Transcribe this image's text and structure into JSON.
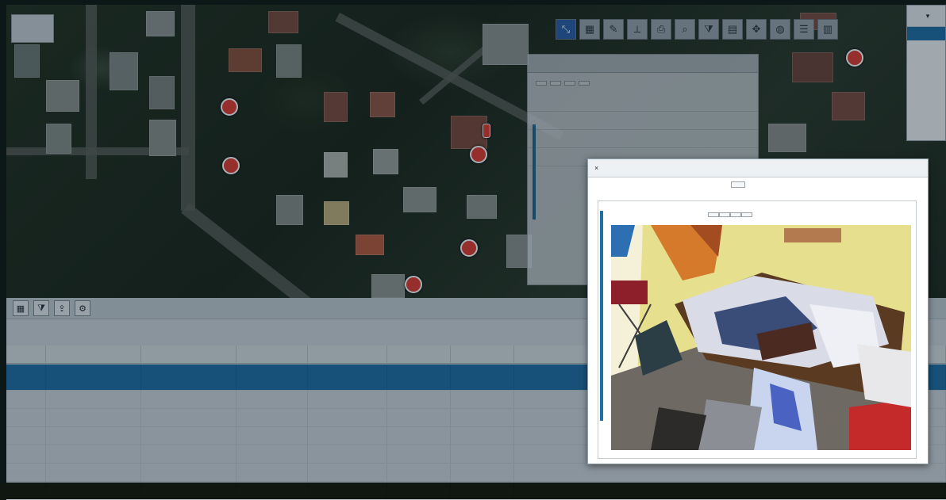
{
  "colors": {
    "accent": "#1f6fa5",
    "marker": "#e23a2f",
    "toolbar_active": "#2a5fa8"
  },
  "map": {
    "logo": "",
    "markers": [
      "",
      "",
      "",
      "",
      "",
      "",
      ""
    ]
  },
  "toolbar": {
    "tools": [
      {
        "icon": "select-icon",
        "glyph": "⤡",
        "active": true
      },
      {
        "icon": "layers-icon",
        "glyph": "▦"
      },
      {
        "icon": "edit-icon",
        "glyph": "✎"
      },
      {
        "icon": "measure-icon",
        "glyph": "⟂"
      },
      {
        "icon": "print-icon",
        "glyph": "⎙"
      },
      {
        "icon": "zoom-icon",
        "glyph": "⌕"
      },
      {
        "icon": "filter-icon",
        "glyph": "⧩"
      },
      {
        "icon": "chart-icon",
        "glyph": "▤"
      },
      {
        "icon": "pan-icon",
        "glyph": "✥"
      },
      {
        "icon": "globe-icon",
        "glyph": "◍"
      },
      {
        "icon": "list-icon",
        "glyph": "☰"
      },
      {
        "icon": "table-icon",
        "glyph": "▥"
      }
    ]
  },
  "side_list": {
    "header": "",
    "items": [
      "",
      "",
      "",
      "",
      "",
      "",
      ""
    ]
  },
  "details": {
    "title": "",
    "rows": [
      [
        "",
        ""
      ],
      [
        "",
        ""
      ],
      [
        "",
        ""
      ],
      [
        "",
        ""
      ]
    ],
    "buttons": [
      "",
      "",
      "",
      ""
    ]
  },
  "grid": {
    "toolbar": [
      {
        "icon": "grid-icon",
        "glyph": "▦"
      },
      {
        "icon": "filter-icon",
        "glyph": "⧩"
      },
      {
        "icon": "export-icon",
        "glyph": "⇪"
      },
      {
        "icon": "settings-icon",
        "glyph": "⚙"
      }
    ],
    "columns": [
      "",
      "",
      "",
      "",
      "",
      "",
      "",
      ""
    ],
    "rows": [
      [
        "",
        "",
        "",
        "",
        "",
        "",
        "",
        ""
      ],
      [
        "",
        "",
        "",
        "",
        "",
        "",
        "",
        ""
      ],
      [
        "",
        "",
        "",
        "",
        "",
        "",
        "",
        ""
      ],
      [
        "",
        "",
        "",
        "",
        "",
        "",
        "",
        ""
      ],
      [
        "",
        "",
        "",
        "",
        "",
        "",
        "",
        ""
      ],
      [
        "",
        "",
        "",
        "",
        "",
        "",
        "",
        ""
      ],
      [
        "",
        "",
        "",
        "",
        "",
        "",
        "",
        ""
      ]
    ],
    "footer": [
      "",
      "",
      "",
      ""
    ]
  },
  "modal": {
    "title": "",
    "button": "",
    "caption": "",
    "tabs": [
      "",
      "",
      "",
      ""
    ]
  }
}
